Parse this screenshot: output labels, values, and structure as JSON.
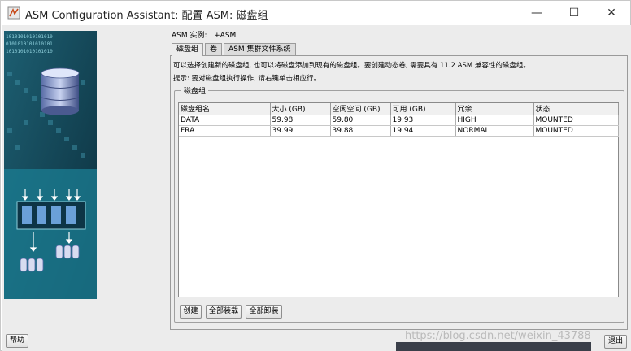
{
  "window": {
    "title": "ASM Configuration Assistant: 配置 ASM: 磁盘组",
    "minimize_glyph": "—",
    "maximize_glyph": "☐",
    "close_glyph": "✕"
  },
  "header": {
    "asm_instance_label": "ASM 实例:",
    "asm_instance_value": "+ASM"
  },
  "tabs": [
    {
      "label": "磁盘组",
      "active": true
    },
    {
      "label": "卷",
      "active": false
    },
    {
      "label": "ASM 集群文件系统",
      "active": false
    }
  ],
  "description": {
    "line1": "可以选择创建新的磁盘组, 也可以将磁盘添加到现有的磁盘组。要创建动态卷, 需要具有 11.2 ASM 兼容性的磁盘组。",
    "line2": "提示: 要对磁盘组执行操作, 请右键单击相应行。"
  },
  "group_box": {
    "title": "磁盘组"
  },
  "table": {
    "columns": [
      "磁盘组名",
      "大小 (GB)",
      "空闲空间 (GB)",
      "可用 (GB)",
      "冗余",
      "状态"
    ],
    "rows": [
      [
        "DATA",
        "59.98",
        "59.80",
        "19.93",
        "HIGH",
        "MOUNTED"
      ],
      [
        "FRA",
        "39.99",
        "39.88",
        "19.94",
        "NORMAL",
        "MOUNTED"
      ]
    ]
  },
  "buttons": {
    "create": "创建",
    "mount_all": "全部装载",
    "unmount_all": "全部卸装",
    "help": "帮助",
    "exit": "退出"
  },
  "watermark": "https://blog.csdn.net/weixin_43788",
  "side_image": {
    "binary_rows": [
      "1010101010101010",
      "0101010101010101",
      "1010101010101010"
    ]
  },
  "colors": {
    "side_dark": "#0f3a4a",
    "side_teal": "#2a8aa0",
    "side_light": "#8fd0dc"
  }
}
